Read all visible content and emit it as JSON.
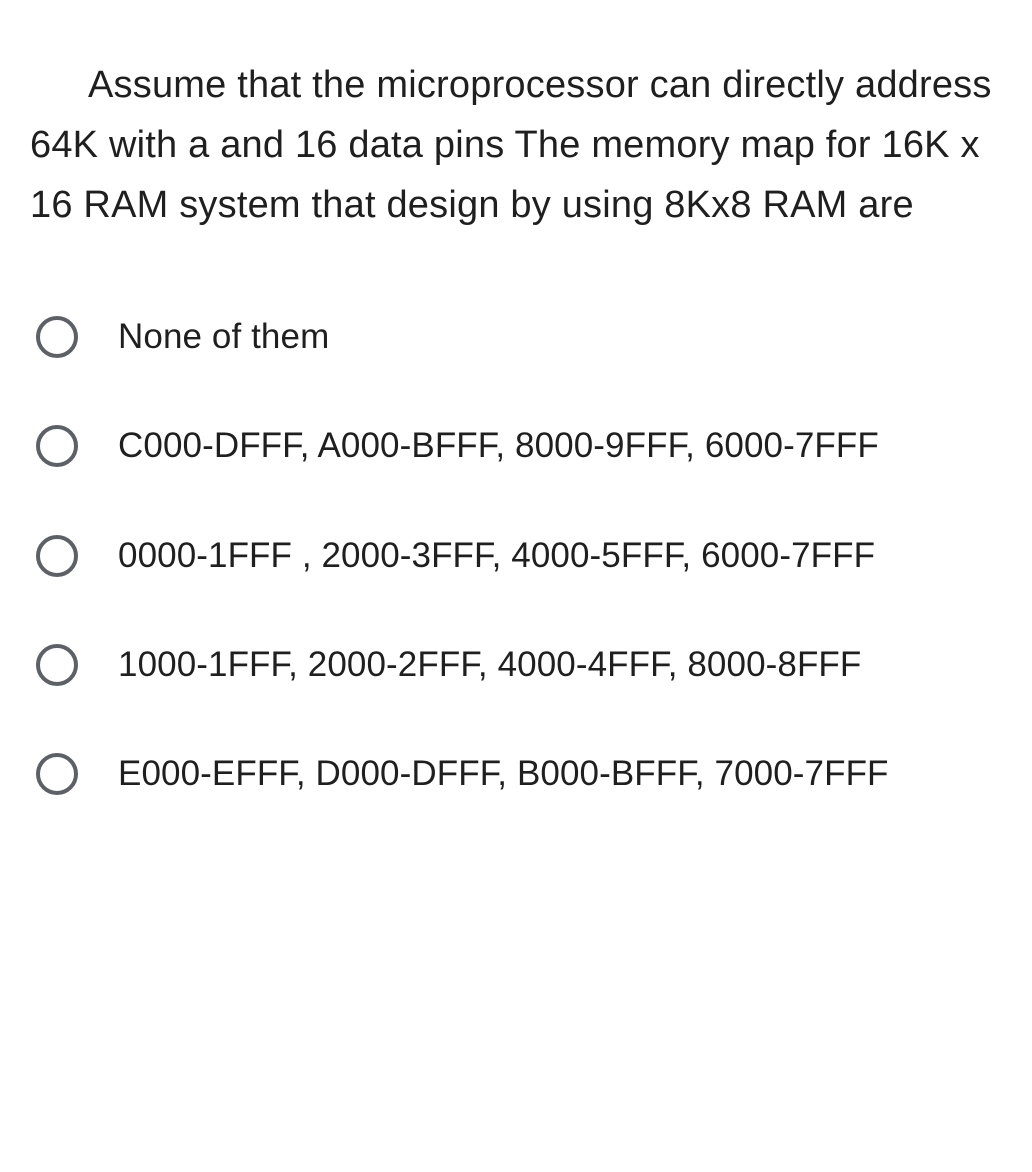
{
  "question": {
    "text": "Assume that the microprocessor can directly address 64K with a and 16 data pins The memory map for 16K x 16 RAM system that design by using 8Kx8 RAM are"
  },
  "options": [
    {
      "label": "None of them"
    },
    {
      "label": "C000-DFFF, A000-BFFF, 8000-9FFF, 6000-7FFF"
    },
    {
      "label": "0000-1FFF , 2000-3FFF, 4000-5FFF, 6000-7FFF"
    },
    {
      "label": "1000-1FFF, 2000-2FFF, 4000-4FFF, 8000-8FFF"
    },
    {
      "label": "E000-EFFF, D000-DFFF, B000-BFFF, 7000-7FFF"
    }
  ]
}
